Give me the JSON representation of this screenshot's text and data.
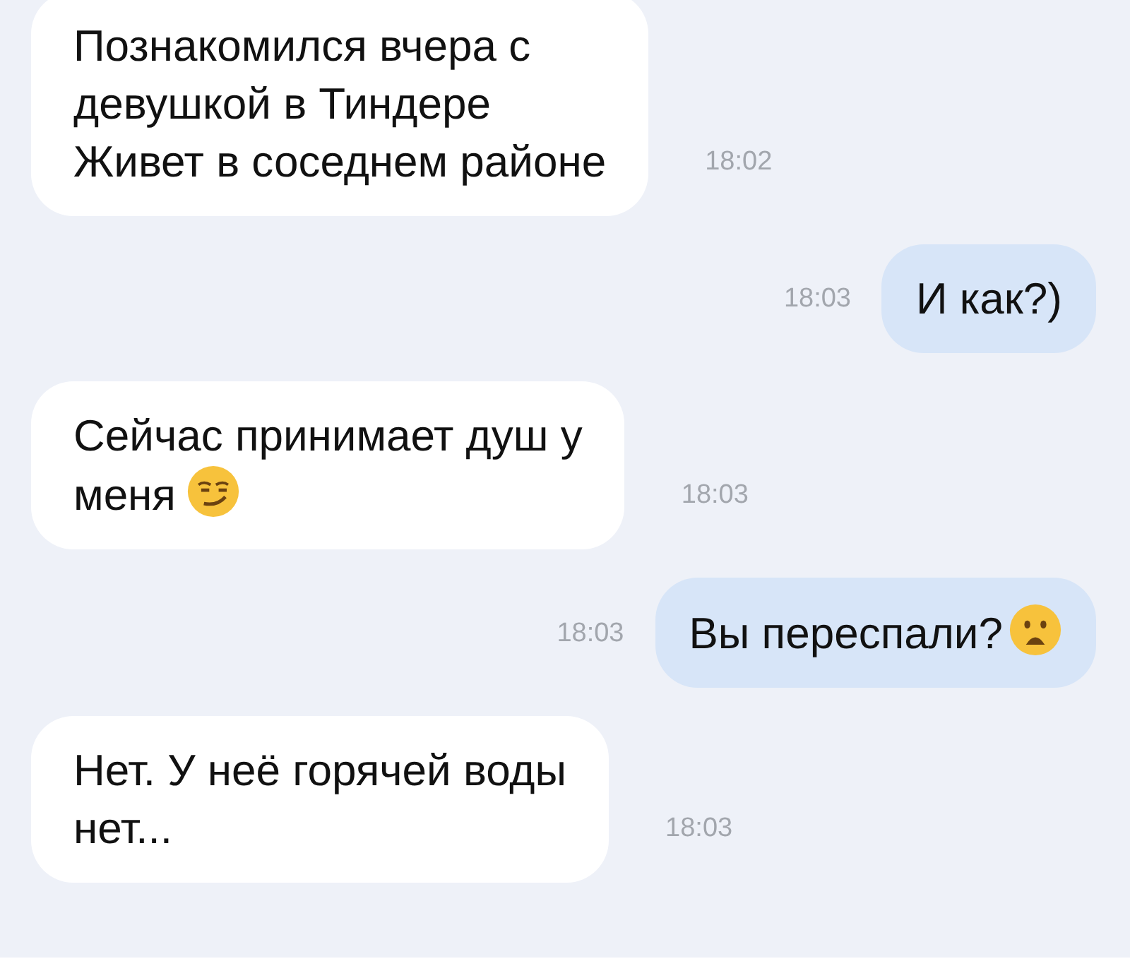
{
  "messages": [
    {
      "kind": "incoming",
      "text": "Познакомился вчера с\nдевушкой в Тиндере\nЖивет в соседнем районе",
      "time": "18:02"
    },
    {
      "kind": "outgoing",
      "text": "И как?)",
      "time": "18:03"
    },
    {
      "kind": "incoming",
      "text": "Сейчас принимает душ у\nменя",
      "emoji": {
        "kind": "smirk"
      },
      "time": "18:03"
    },
    {
      "kind": "outgoing",
      "text": "Вы переспали?",
      "emoji": {
        "kind": "frown"
      },
      "time": "18:03"
    },
    {
      "kind": "incoming",
      "text": "Нет. У неё горячей воды\nнет...",
      "time": "18:03"
    }
  ]
}
